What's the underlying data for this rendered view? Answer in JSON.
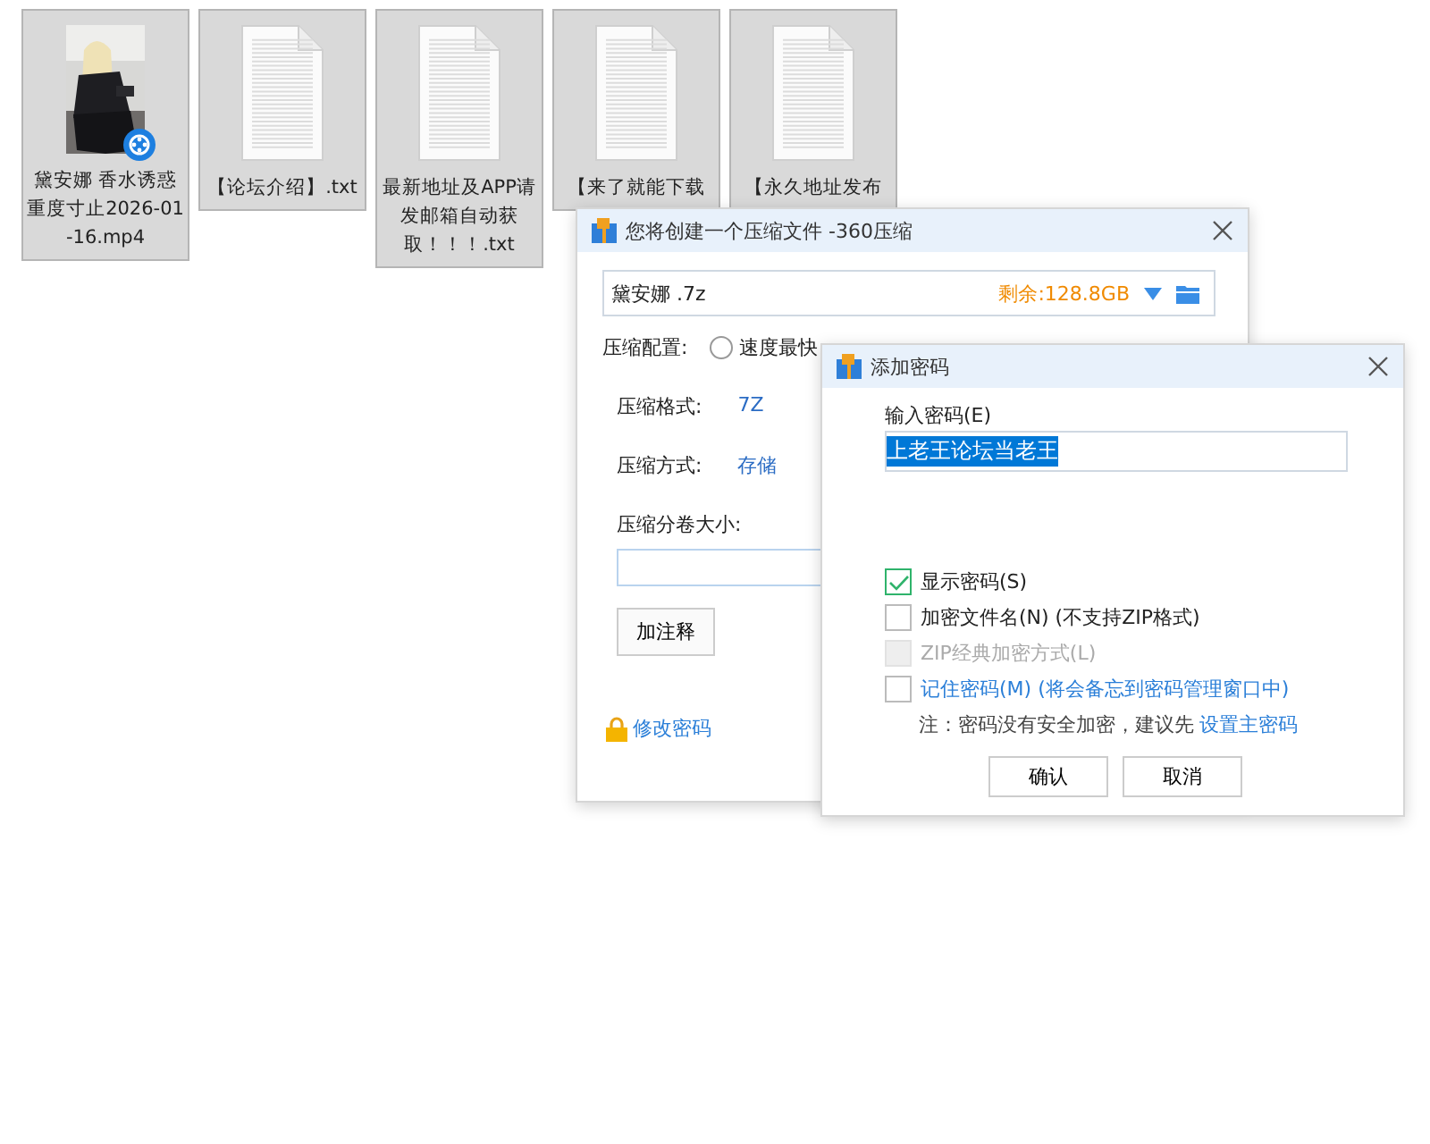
{
  "files": [
    {
      "kind": "video",
      "name": "黛安娜 香水诱惑重度寸止2026-01-16.mp4",
      "selected": true
    },
    {
      "kind": "text",
      "name": "【论坛介绍】.txt",
      "selected": true
    },
    {
      "kind": "text",
      "name": "最新地址及APP请发邮箱自动获取！！！.txt",
      "selected": true
    },
    {
      "kind": "text",
      "name": "【来了就能下载",
      "selected": true
    },
    {
      "kind": "text",
      "name": "【永久地址发布",
      "selected": true
    }
  ],
  "compress_window": {
    "title": "您将创建一个压缩文件 -360压缩",
    "path": "黛安娜 .7z",
    "free_space": "剩余:128.8GB",
    "config_label": "压缩配置:",
    "config_options": [
      {
        "label": "速度最快",
        "selected": false
      }
    ],
    "settings": [
      {
        "label": "压缩格式:",
        "value": "7Z"
      },
      {
        "label": "压缩方式:",
        "value": "存储"
      }
    ],
    "volume_label": "压缩分卷大小:",
    "comment_button": "加注释",
    "change_password": "修改密码"
  },
  "password_dialog": {
    "title": "添加密码",
    "input_label": "输入密码(E)",
    "password": "上老王论坛当老王",
    "options": [
      {
        "kind": "plain",
        "label": "显示密码(S)",
        "checked": true,
        "disabled": false
      },
      {
        "kind": "plain",
        "label": "加密文件名(N) (不支持ZIP格式)",
        "checked": false,
        "disabled": false
      },
      {
        "kind": "plain",
        "label": "ZIP经典加密方式(L)",
        "checked": false,
        "disabled": true
      },
      {
        "kind": "link",
        "label": "记住密码(M) (将会备忘到密码管理窗口中)",
        "checked": false,
        "disabled": false
      }
    ],
    "note": "注：密码没有安全加密，建议先",
    "note_link": "设置主密码",
    "buttons": [
      "确认",
      "取消"
    ]
  }
}
